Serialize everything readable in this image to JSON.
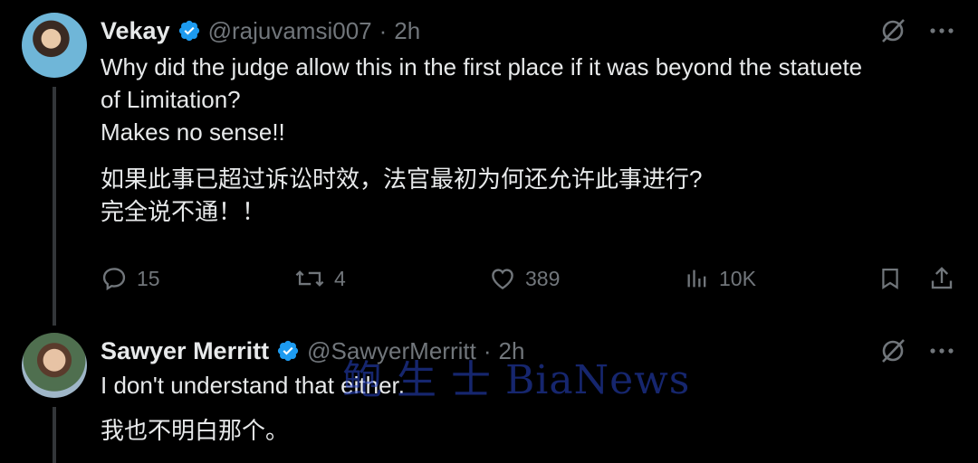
{
  "tweets": [
    {
      "name": "Vekay",
      "handle": "@rajuvamsi007",
      "separator": "·",
      "time": "2h",
      "text_en_lines": [
        "Why did the judge allow this in the first place if it was beyond the statuete",
        "of Limitation?",
        "Makes no sense!!"
      ],
      "text_zh_lines": [
        "如果此事已超过诉讼时效，法官最初为何还允许此事进行?",
        "完全说不通！！"
      ],
      "stats": {
        "replies": "15",
        "retweets": "4",
        "likes": "389",
        "views": "10K"
      }
    },
    {
      "name": "Sawyer Merritt",
      "handle": "@SawyerMerritt",
      "separator": "·",
      "time": "2h",
      "text_en": "I don't understand that either.",
      "text_zh": "我也不明白那个。"
    }
  ],
  "watermark": "鲍 生 士 BiaNews",
  "colors": {
    "background": "#000000",
    "text": "#e7e9ea",
    "muted": "#71767b",
    "verified": "#1d9bf0",
    "thread_line": "#333639"
  },
  "icons": [
    "verified-badge-icon",
    "grok-icon",
    "more-icon",
    "reply-icon",
    "retweet-icon",
    "like-icon",
    "views-icon",
    "bookmark-icon",
    "share-icon"
  ]
}
